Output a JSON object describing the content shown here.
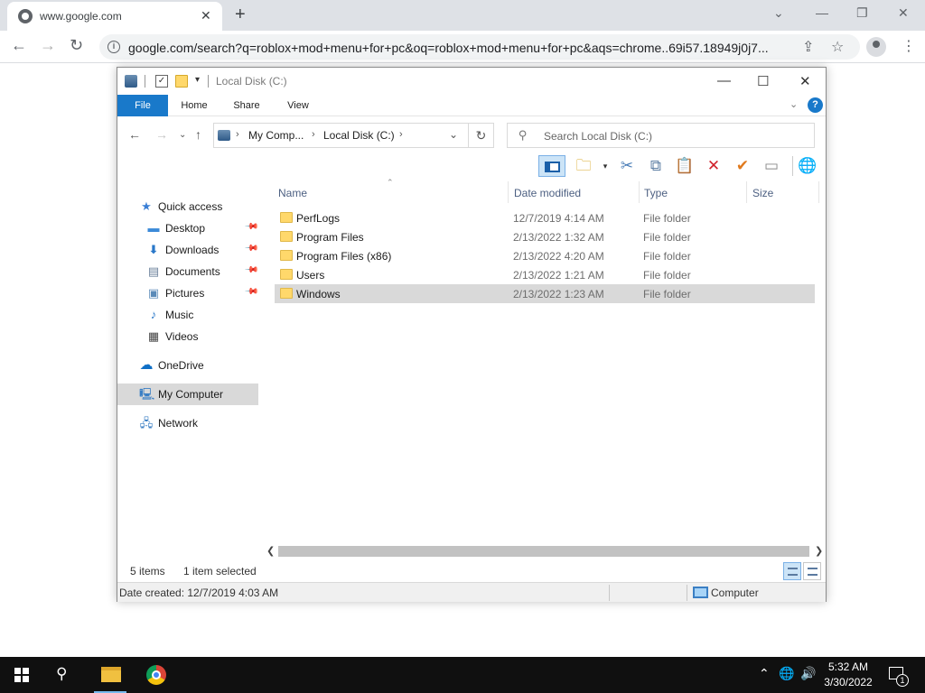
{
  "browser": {
    "tab_title": "www.google.com",
    "url": "google.com/search?q=roblox+mod+menu+for+pc&oq=roblox+mod+menu+for+pc&aqs=chrome..69i57.18949j0j7..."
  },
  "explorer": {
    "window_title": "Local Disk (C:)",
    "ribbon_tabs": [
      "File",
      "Home",
      "Share",
      "View"
    ],
    "breadcrumb": [
      "My Comp...",
      "Local Disk (C:)"
    ],
    "search_placeholder": "Search Local Disk (C:)",
    "columns": {
      "name": "Name",
      "date": "Date modified",
      "type": "Type",
      "size": "Size"
    },
    "nav": {
      "quick_access": "Quick access",
      "desktop": "Desktop",
      "downloads": "Downloads",
      "documents": "Documents",
      "pictures": "Pictures",
      "music": "Music",
      "videos": "Videos",
      "onedrive": "OneDrive",
      "my_computer": "My Computer",
      "network": "Network"
    },
    "files": [
      {
        "name": "PerfLogs",
        "date": "12/7/2019 4:14 AM",
        "type": "File folder"
      },
      {
        "name": "Program Files",
        "date": "2/13/2022 1:32 AM",
        "type": "File folder"
      },
      {
        "name": "Program Files (x86)",
        "date": "2/13/2022 4:20 AM",
        "type": "File folder"
      },
      {
        "name": "Users",
        "date": "2/13/2022 1:21 AM",
        "type": "File folder"
      },
      {
        "name": "Windows",
        "date": "2/13/2022 1:23 AM",
        "type": "File folder"
      }
    ],
    "status": {
      "item_count": "5 items",
      "selected": "1 item selected",
      "date_created": "Date created: 12/7/2019 4:03 AM",
      "location": "Computer"
    }
  },
  "taskbar": {
    "time": "5:32 AM",
    "date": "3/30/2022",
    "notification_count": "1"
  },
  "colors": {
    "accent": "#1979ca",
    "selection": "#d9d9d9",
    "taskbar": "#101010",
    "folder": "#ffd86b"
  }
}
